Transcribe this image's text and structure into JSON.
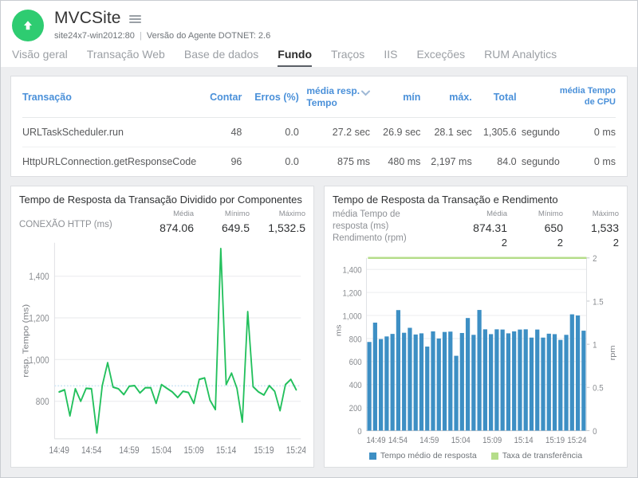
{
  "header": {
    "logo_icon": "upload-arrow-circle-icon",
    "title": "MVCSite",
    "menu_icon": "hamburger-menu-icon",
    "host": "site24x7-win2012:80",
    "separator": "|",
    "agent_version": "Versão do Agente DOTNET: 2.6"
  },
  "tabs": [
    {
      "label": "Visão geral",
      "active": false
    },
    {
      "label": "Transação Web",
      "active": false
    },
    {
      "label": "Base de dados",
      "active": false
    },
    {
      "label": "Fundo",
      "active": true
    },
    {
      "label": "Traços",
      "active": false
    },
    {
      "label": "IIS",
      "active": false
    },
    {
      "label": "Exceções",
      "active": false
    },
    {
      "label": "RUM Analytics",
      "active": false
    }
  ],
  "table": {
    "columns": {
      "transaction": "Transação",
      "count": "Contar",
      "errors": "Erros (%)",
      "avg_resp_line1": "média resp.",
      "avg_resp_line2": "Tempo",
      "sort_icon": "chevron-down-icon",
      "min": "mín",
      "max": "máx.",
      "total": "Total",
      "cpu_line1": "média Tempo",
      "cpu_line2": "de CPU"
    },
    "rows": [
      {
        "transaction": "URLTaskScheduler.run",
        "count": "48",
        "errors": "0.0",
        "avg_resp": "27.2 sec",
        "min": "26.9 sec",
        "max": "28.1 sec",
        "total": "1,305.6",
        "total_unit": "segundo",
        "cpu": "0 ms"
      },
      {
        "transaction": "HttpURLConnection.getResponseCode",
        "count": "96",
        "errors": "0.0",
        "avg_resp": "875 ms",
        "min": "480 ms",
        "max": "2,197 ms",
        "total": "84.0",
        "total_unit": "segundo",
        "cpu": "0 ms"
      }
    ]
  },
  "left_chart_panel": {
    "title": "Tempo de Resposta da Transação Dividido por Componentes",
    "series_label": "CONEXÃO HTTP (ms)",
    "stat_headers": {
      "avg": "Média",
      "min": "Mínimo",
      "max": "Máximo"
    },
    "stat_values": {
      "avg": "874.06",
      "min": "649.5",
      "max": "1,532.5"
    }
  },
  "right_chart_panel": {
    "title": "Tempo de Resposta da Transação e Rendimento",
    "series_label_line1": "média Tempo de",
    "series_label_line2": "resposta (ms)",
    "series_label_line3": "Rendimento (rpm)",
    "stat_headers": {
      "avg": "Média",
      "min": "Mínimo",
      "max": "Máximo"
    },
    "stat_values_resp": {
      "avg": "874.31",
      "min": "650",
      "max": "1,533"
    },
    "stat_values_thr": {
      "avg": "2",
      "min": "2",
      "max": "2"
    },
    "legend": [
      {
        "label": "Tempo médio de resposta",
        "color": "#3d8fc4"
      },
      {
        "label": "Taxa de transferência",
        "color": "#b5dd8a"
      }
    ]
  },
  "colors": {
    "brand_green": "#2ecc71",
    "line_green": "#22c05c",
    "bar_blue": "#3d8fc4",
    "throughput_green": "#b5dd8a",
    "link_blue": "#4a90d9",
    "page_bg": "#edeef0"
  },
  "chart_data": [
    {
      "type": "line",
      "title": "Tempo de Resposta da Transação Dividido por Componentes",
      "xlabel": "",
      "ylabel": "resp. Tempo (ms)",
      "ylim": [
        620,
        1560
      ],
      "yticks": [
        800,
        1000,
        1200,
        1400
      ],
      "ytick_labels": [
        "800",
        "1,000",
        "1,200",
        "1,400"
      ],
      "grid": true,
      "xticks": [
        "14:49",
        "14:54",
        "14:59",
        "15:04",
        "15:09",
        "15:14",
        "15:19",
        "15:24"
      ],
      "series": [
        {
          "name": "CONEXÃO HTTP (ms)",
          "color": "#22c05c",
          "values": [
            845,
            855,
            730,
            860,
            800,
            862,
            860,
            648,
            875,
            985,
            868,
            860,
            832,
            872,
            875,
            840,
            865,
            865,
            790,
            880,
            862,
            845,
            818,
            848,
            842,
            790,
            905,
            912,
            805,
            760,
            1532,
            880,
            935,
            862,
            700,
            1230,
            870,
            845,
            830,
            875,
            848,
            755,
            880,
            905,
            855
          ]
        },
        {
          "name": "média",
          "color": "#cfe6f5",
          "style": "dotted",
          "value": 874.06
        }
      ]
    },
    {
      "type": "bar",
      "title": "Tempo de Resposta da Transação e Rendimento",
      "xlabel": "",
      "ylabel": "ms",
      "y2label": "rpm",
      "ylim": [
        0,
        1500
      ],
      "yticks": [
        0,
        200,
        400,
        600,
        800,
        1000,
        1200,
        1400
      ],
      "ytick_labels": [
        "0",
        "200",
        "400",
        "600",
        "800",
        "1,000",
        "1,200",
        "1,400"
      ],
      "y2lim": [
        0,
        2
      ],
      "y2ticks": [
        0,
        0.5,
        1,
        1.5,
        2
      ],
      "y2tick_labels": [
        "0",
        "0.5",
        "1",
        "1.5",
        "2"
      ],
      "grid": true,
      "xticks": [
        "14:49",
        "14:54",
        "14:59",
        "15:04",
        "15:09",
        "15:14",
        "15:19",
        "15:24"
      ],
      "series": [
        {
          "name": "Tempo médio de resposta",
          "color": "#3d8fc4",
          "kind": "bar",
          "values": [
            770,
            938,
            795,
            818,
            840,
            1047,
            850,
            893,
            835,
            845,
            730,
            862,
            800,
            857,
            860,
            650,
            848,
            978,
            832,
            1048,
            880,
            838,
            880,
            878,
            845,
            862,
            878,
            880,
            808,
            878,
            808,
            842,
            838,
            788,
            832,
            1010,
            1000,
            868
          ]
        },
        {
          "name": "Taxa de transferência",
          "color": "#b5dd8a",
          "kind": "line",
          "axis": "y2",
          "constant": 2
        }
      ]
    }
  ]
}
